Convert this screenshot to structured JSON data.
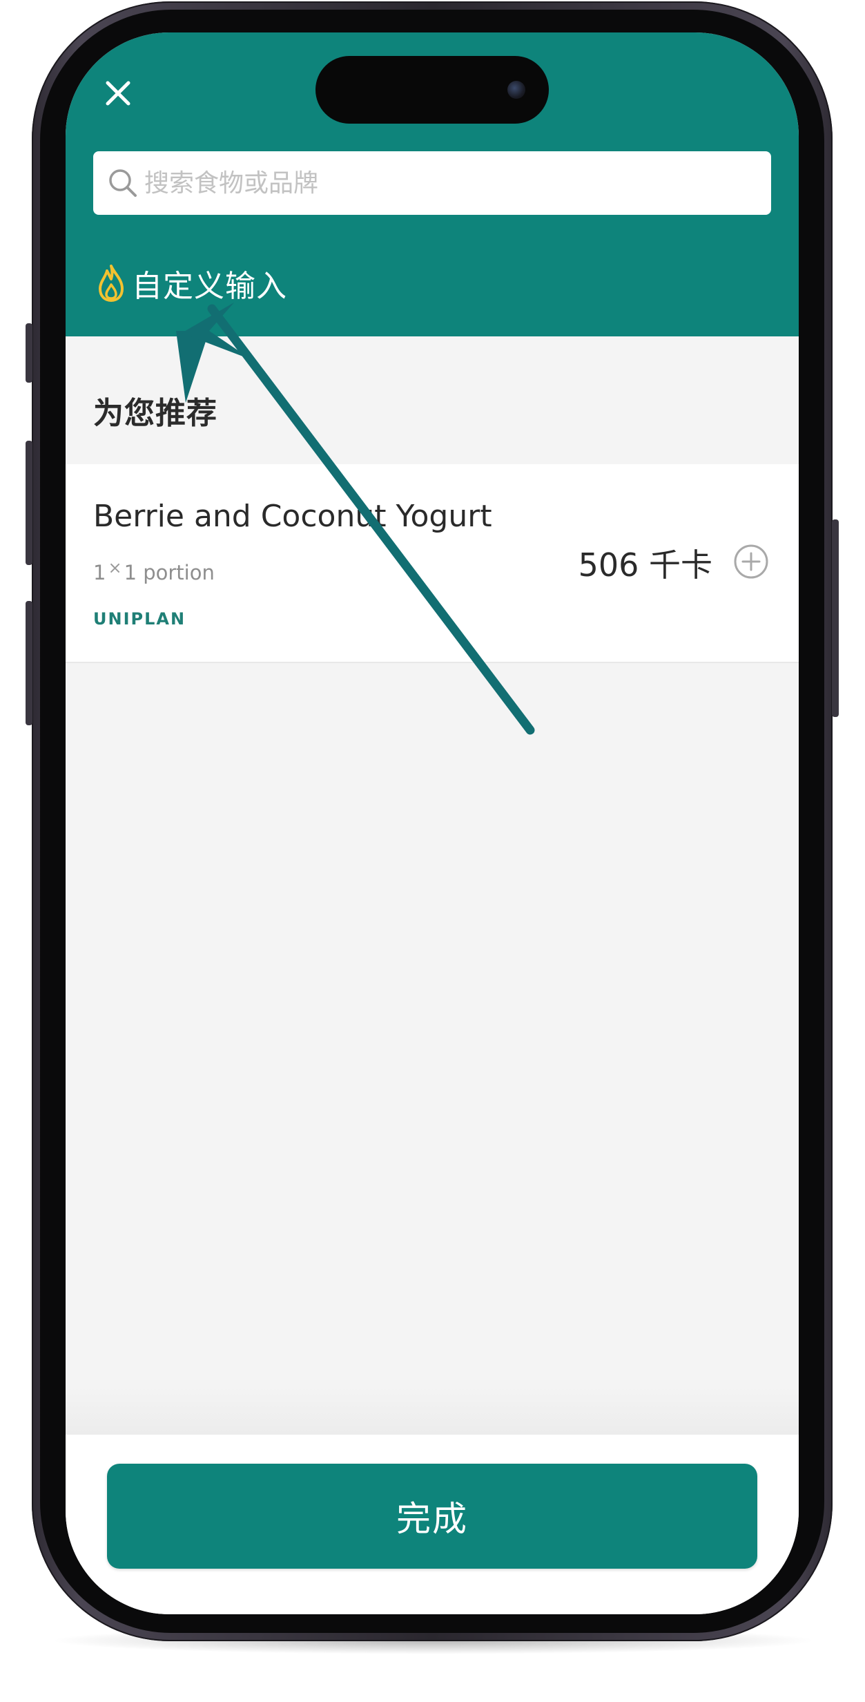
{
  "header": {
    "close_icon": "close-icon",
    "search": {
      "placeholder": "搜索食物或品牌",
      "value": "",
      "icon": "search-icon"
    },
    "custom_entry": {
      "icon": "flame-icon",
      "label": "自定义输入"
    }
  },
  "recommendations": {
    "section_title": "为您推荐",
    "items": [
      {
        "name": "Berrie and Coconut Yogurt",
        "quantity": "1",
        "portion": "1 portion",
        "brand": "UNIPLAN",
        "calories": "506 千卡",
        "add_icon": "plus-circle-icon"
      }
    ]
  },
  "footer": {
    "done_label": "完成"
  },
  "colors": {
    "brand_teal": "#0e847b",
    "flame_yellow": "#f2c230",
    "brand_text": "#1f7f76",
    "annotation_arrow": "#126e72"
  }
}
